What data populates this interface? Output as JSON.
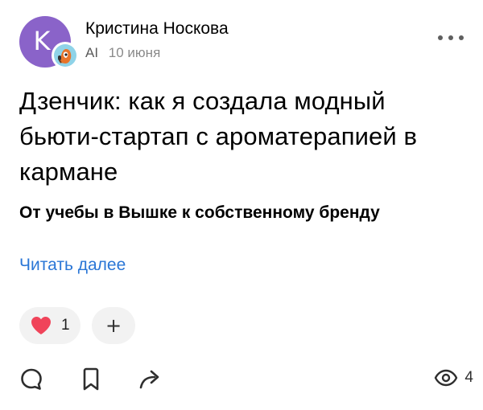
{
  "post": {
    "author": {
      "name": "Кристина Носкова",
      "avatar_letter": "K",
      "avatar_color": "#8a63c9"
    },
    "source": "AI",
    "date": "10 июня",
    "title": "Дзенчик: как я создала модный бьюти-стартап с ароматерапией в кармане",
    "subtitle": "От учебы в Вышке к собственному бренду",
    "read_more": "Читать далее",
    "reactions": {
      "heart_count": "1",
      "heart_color": "#f0445a",
      "add_label": "+"
    },
    "views": "4",
    "accent_color": "#2a76d6",
    "icons": [
      "more-icon",
      "heart-icon",
      "comment-icon",
      "bookmark-icon",
      "share-icon",
      "eye-icon"
    ]
  }
}
